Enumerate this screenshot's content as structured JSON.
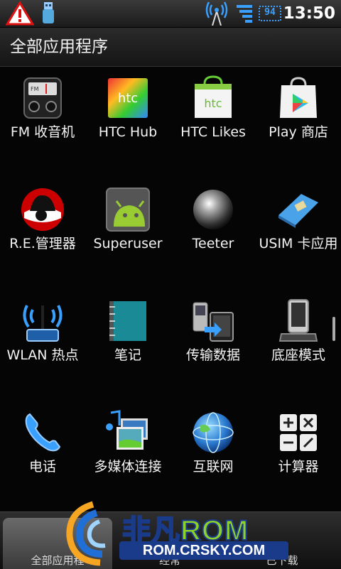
{
  "status_bar": {
    "time": "13:50",
    "battery": "94",
    "icons": [
      "warning-icon",
      "usb-icon",
      "signal-icon",
      "wifi-icon",
      "battery-icon"
    ]
  },
  "header": {
    "title": "全部应用程序"
  },
  "apps": [
    {
      "label": "FM 收音机",
      "icon": "fm-radio-icon"
    },
    {
      "label": "HTC Hub",
      "icon": "htc-hub-icon"
    },
    {
      "label": "HTC Likes",
      "icon": "htc-likes-icon"
    },
    {
      "label": "Play 商店",
      "icon": "play-store-icon"
    },
    {
      "label": "R.E.管理器",
      "icon": "redhat-icon"
    },
    {
      "label": "Superuser",
      "icon": "android-icon"
    },
    {
      "label": "Teeter",
      "icon": "ball-icon"
    },
    {
      "label": "USIM 卡应用",
      "icon": "sim-card-icon"
    },
    {
      "label": "WLAN 热点",
      "icon": "wlan-hotspot-icon"
    },
    {
      "label": "笔记",
      "icon": "notebook-icon"
    },
    {
      "label": "传输数据",
      "icon": "transfer-icon"
    },
    {
      "label": "底座模式",
      "icon": "dock-icon"
    },
    {
      "label": "电话",
      "icon": "phone-icon"
    },
    {
      "label": "多媒体连接",
      "icon": "media-connect-icon"
    },
    {
      "label": "互联网",
      "icon": "globe-icon"
    },
    {
      "label": "计算器",
      "icon": "calculator-icon"
    }
  ],
  "bottom_tabs": [
    {
      "label": "全部应用程"
    },
    {
      "label": "经常"
    },
    {
      "label": "已下载"
    }
  ],
  "watermark": {
    "brand_part1": "非凡",
    "brand_part2": "ROM",
    "url": "ROM.CRSKY.COM"
  },
  "colors": {
    "accent": "#3aa0ff",
    "brand_green": "#8ed12b",
    "warning": "#d11"
  }
}
